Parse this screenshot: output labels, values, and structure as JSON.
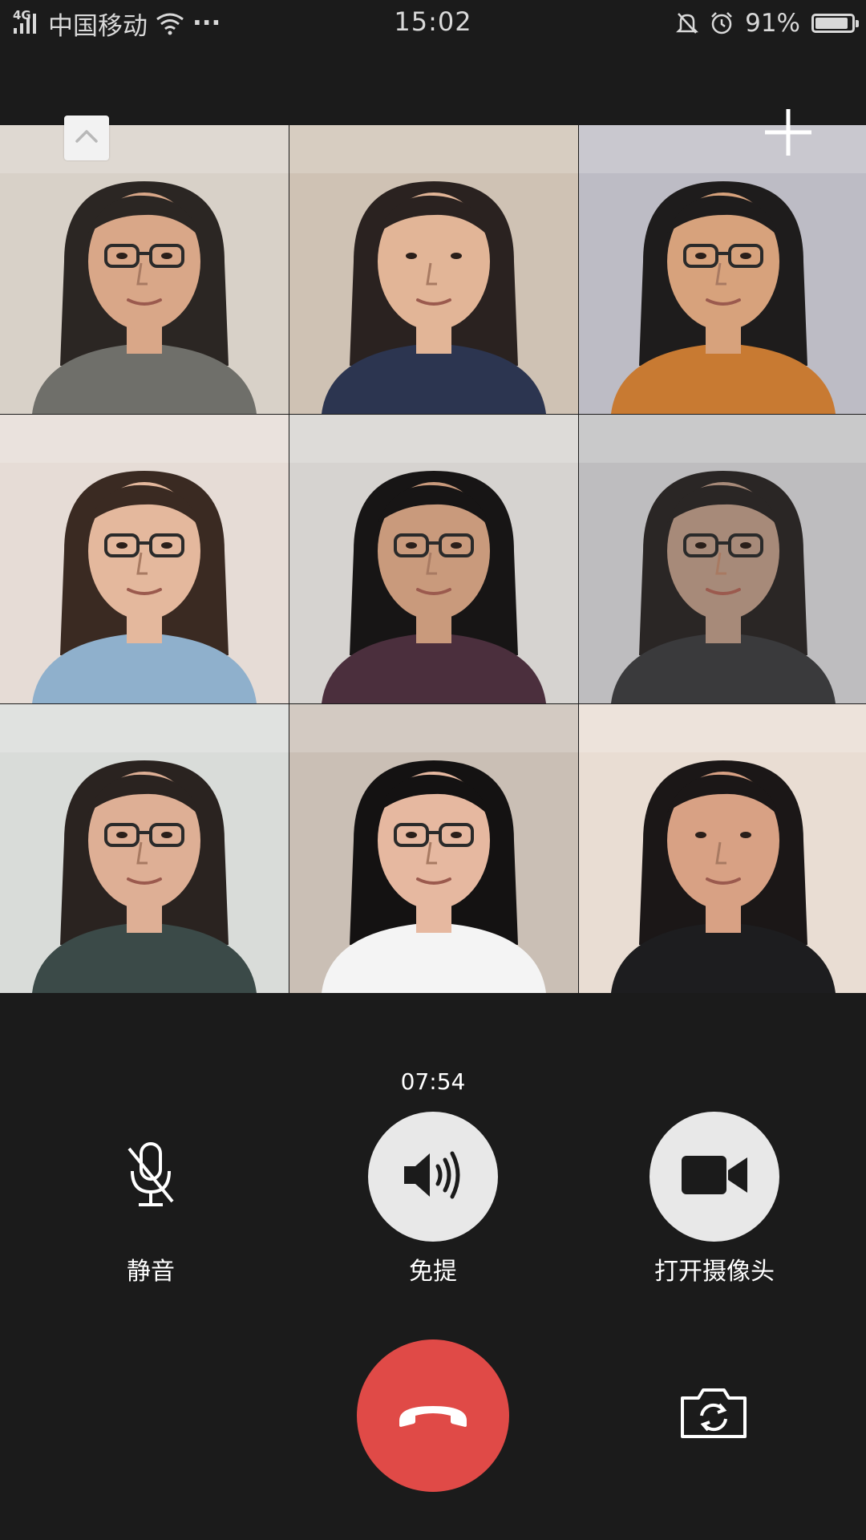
{
  "status_bar": {
    "network_type": "4G",
    "carrier": "中国移动",
    "more": "···",
    "time": "15:02",
    "battery_percent": "91%",
    "battery_level": 0.91
  },
  "call": {
    "duration": "07:54"
  },
  "controls": {
    "mute_label": "静音",
    "speaker_label": "免提",
    "camera_label": "打开摄像头"
  },
  "participants": [
    {
      "bg": "#d8d1c8",
      "skin": "#d9a788",
      "hair": "#2b2623",
      "shirt": "#6f6f6a",
      "glasses": true
    },
    {
      "bg": "#cfc2b4",
      "skin": "#e2b597",
      "hair": "#2a2220",
      "shirt": "#2c3550",
      "glasses": false
    },
    {
      "bg": "#bdbcc5",
      "skin": "#d7a27c",
      "hair": "#1e1c1c",
      "shirt": "#c87a32",
      "glasses": true
    },
    {
      "bg": "#e6dcd6",
      "skin": "#e4b89d",
      "hair": "#3a2a22",
      "shirt": "#8fb0cc",
      "glasses": true
    },
    {
      "bg": "#d6d3d0",
      "skin": "#c99a7c",
      "hair": "#171515",
      "shirt": "#4b2f3d",
      "glasses": true
    },
    {
      "bg": "#bebdbf",
      "skin": "#a78a79",
      "hair": "#2a2625",
      "shirt": "#3a3a3c",
      "glasses": true
    },
    {
      "bg": "#d9dcd9",
      "skin": "#deaf95",
      "hair": "#2a2320",
      "shirt": "#3b4a48",
      "glasses": true
    },
    {
      "bg": "#cabfb5",
      "skin": "#e6b8a0",
      "hair": "#141212",
      "shirt": "#f4f4f4",
      "glasses": true
    },
    {
      "bg": "#e9ddd3",
      "skin": "#d8a184",
      "hair": "#1b1717",
      "shirt": "#1d1d1f",
      "glasses": false
    }
  ],
  "colors": {
    "background": "#1b1b1b",
    "hangup": "#e04a47",
    "control_circle": "#e8e8e8"
  }
}
